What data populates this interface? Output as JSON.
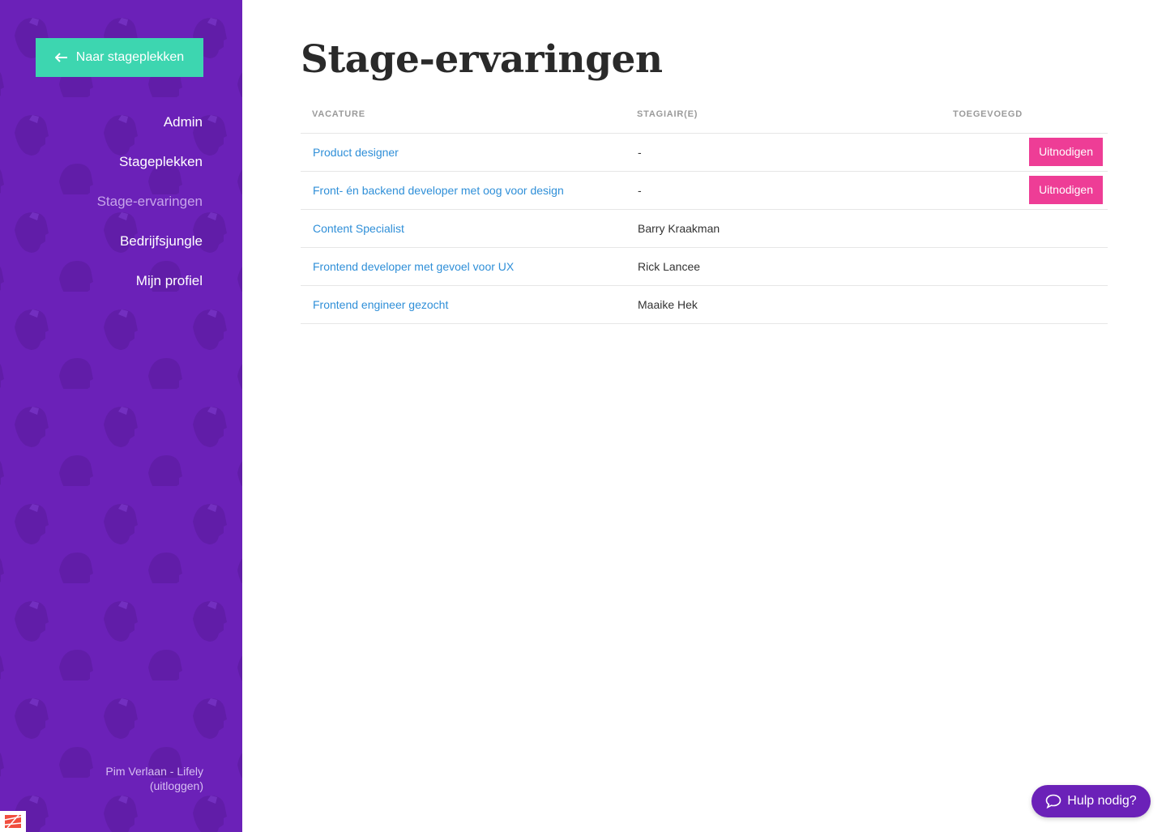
{
  "sidebar": {
    "back_label": "Naar stageplekken",
    "nav": [
      {
        "label": "Admin",
        "active": false
      },
      {
        "label": "Stageplekken",
        "active": false
      },
      {
        "label": "Stage-ervaringen",
        "active": true
      },
      {
        "label": "Bedrijfsjungle",
        "active": false
      },
      {
        "label": "Mijn profiel",
        "active": false
      }
    ],
    "user_line": "Pim Verlaan - Lifely",
    "logout_label": "(uitloggen)"
  },
  "main": {
    "title": "Stage-ervaringen",
    "table": {
      "headers": {
        "vacature": "Vacature",
        "stagiair": "Stagiair(e)",
        "toegevoegd": "Toegevoegd"
      },
      "rows": [
        {
          "vacature": "Product designer",
          "stagiair": "-",
          "action": "Uitnodigen"
        },
        {
          "vacature": "Front- én backend developer met oog voor design",
          "stagiair": "-",
          "action": "Uitnodigen"
        },
        {
          "vacature": "Content Specialist",
          "stagiair": "Barry Kraakman",
          "action": null
        },
        {
          "vacature": "Frontend developer met gevoel voor UX",
          "stagiair": "Rick Lancee",
          "action": null
        },
        {
          "vacature": "Frontend engineer gezocht",
          "stagiair": "Maaike Hek",
          "action": null
        }
      ]
    }
  },
  "help": {
    "label": "Hulp nodig?"
  },
  "colors": {
    "sidebar_bg": "#6b21b8",
    "back_button": "#3dd6b0",
    "link": "#2f8fd8",
    "invite_button": "#ee3d96"
  },
  "icons": {
    "back": "arrow-left-icon",
    "help": "chat-bubble-icon",
    "pattern": "portrait-pattern",
    "logo": "bottom-logo-icon"
  }
}
